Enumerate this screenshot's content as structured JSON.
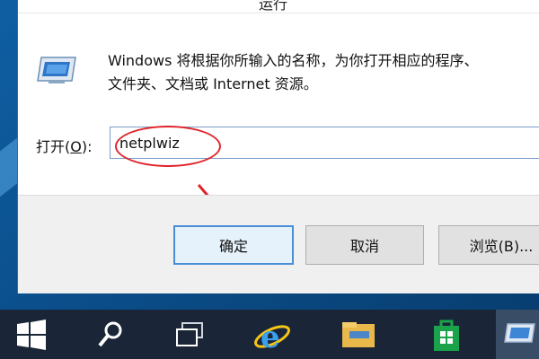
{
  "dialog": {
    "title": "运行",
    "description_line1": "Windows 将根据你所输入的名称，为你打开相应的程序、",
    "description_line2": "文件夹、文档或 Internet 资源。",
    "open_label_prefix": "打开(",
    "open_label_key": "O",
    "open_label_suffix": "):",
    "open_value": "netplwiz",
    "ok_label": "确定",
    "cancel_label": "取消",
    "browse_label": "浏览(B)..."
  },
  "taskbar": {
    "items": [
      "start-icon",
      "search-icon",
      "task-view-icon",
      "ie-icon",
      "file-explorer-icon",
      "store-icon",
      "run-app-icon"
    ]
  },
  "colors": {
    "highlight": "#e0242c",
    "taskbar": "#1a2637",
    "desktop": "#0b4f8c",
    "accent": "#4a8ed6"
  }
}
